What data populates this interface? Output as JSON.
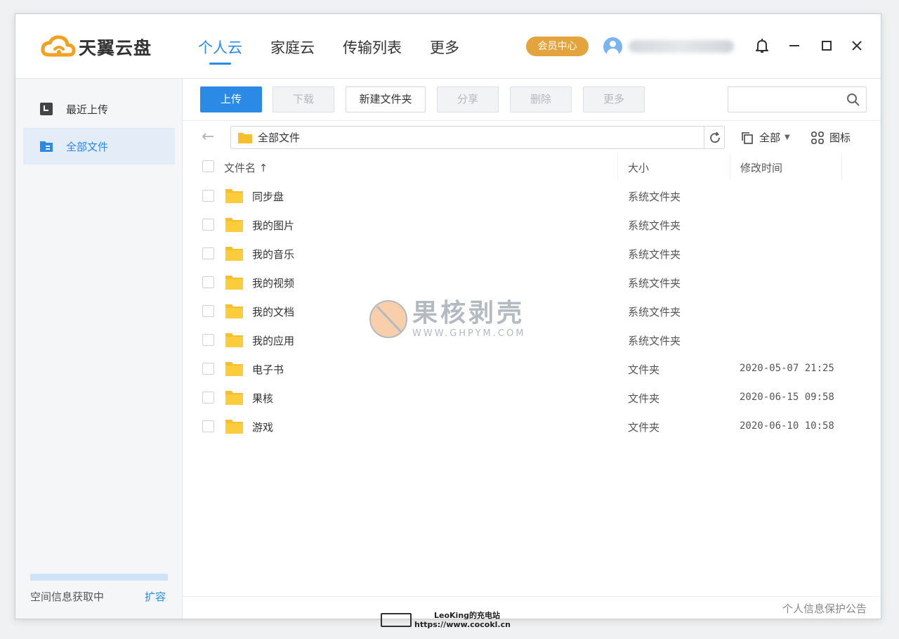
{
  "app": {
    "logo_text": "天翼云盘",
    "nav": [
      {
        "label": "个人云",
        "active": true
      },
      {
        "label": "家庭云",
        "active": false
      },
      {
        "label": "传输列表",
        "active": false
      },
      {
        "label": "更多",
        "active": false
      }
    ],
    "vip_label": "会员中心",
    "username": "",
    "accent_color": "#2a8ae6",
    "vip_color": "#e3a43e"
  },
  "sidebar": {
    "items": [
      {
        "label": "最近上传",
        "icon": "recent-upload-icon",
        "active": false
      },
      {
        "label": "全部文件",
        "icon": "all-files-icon",
        "active": true
      }
    ],
    "quota_text": "空间信息获取中",
    "expand_label": "扩容"
  },
  "toolbar": {
    "upload": "上传",
    "download": "下载",
    "new_folder": "新建文件夹",
    "share": "分享",
    "delete": "删除",
    "more": "更多",
    "search_placeholder": ""
  },
  "pathbar": {
    "current": "全部文件",
    "filter_label": "全部",
    "view_label": "图标"
  },
  "table": {
    "headers": {
      "name": "文件名 ↑",
      "size": "大小",
      "modified": "修改时间"
    },
    "rows": [
      {
        "name": "同步盘",
        "size": "系统文件夹",
        "time": ""
      },
      {
        "name": "我的图片",
        "size": "系统文件夹",
        "time": ""
      },
      {
        "name": "我的音乐",
        "size": "系统文件夹",
        "time": ""
      },
      {
        "name": "我的视频",
        "size": "系统文件夹",
        "time": ""
      },
      {
        "name": "我的文档",
        "size": "系统文件夹",
        "time": ""
      },
      {
        "name": "我的应用",
        "size": "系统文件夹",
        "time": ""
      },
      {
        "name": "电子书",
        "size": "文件夹",
        "time": "2020-05-07 21:25"
      },
      {
        "name": "果核",
        "size": "文件夹",
        "time": "2020-06-15 09:58"
      },
      {
        "name": "游戏",
        "size": "文件夹",
        "time": "2020-06-10 10:58"
      }
    ]
  },
  "footer": {
    "privacy_link": "个人信息保护公告"
  },
  "watermark": {
    "title": "果核剥壳",
    "sub": "WWW.GHPYM.COM",
    "bottom_line1": "LeoKing的充电站",
    "bottom_line2": "https://www.cocokl.cn"
  }
}
